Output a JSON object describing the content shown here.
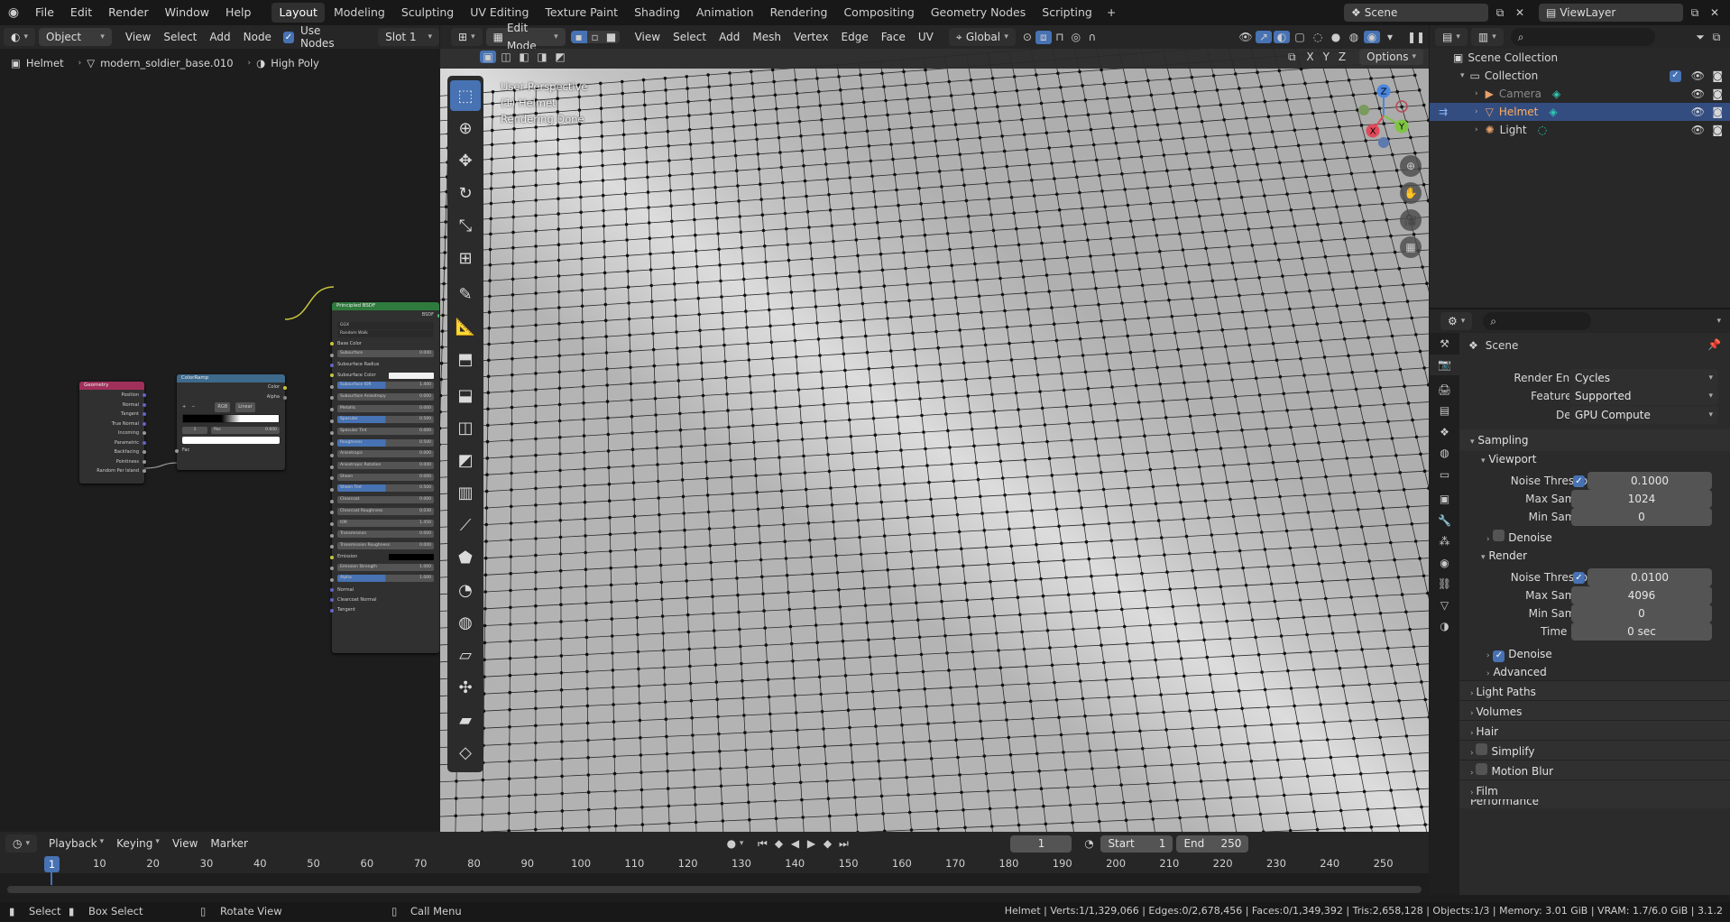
{
  "topbar": {
    "menus": [
      "File",
      "Edit",
      "Render",
      "Window",
      "Help"
    ],
    "workspaces": [
      "Layout",
      "Modeling",
      "Sculpting",
      "UV Editing",
      "Texture Paint",
      "Shading",
      "Animation",
      "Rendering",
      "Compositing",
      "Geometry Nodes",
      "Scripting"
    ],
    "active_workspace": "Layout",
    "add_tab": "+",
    "scene": "Scene",
    "view_layer": "ViewLayer"
  },
  "node_header": {
    "mode": "Object",
    "menus": [
      "View",
      "Select",
      "Add",
      "Node"
    ],
    "use_nodes": "Use Nodes",
    "slot": "Slot 1"
  },
  "breadcrumb": {
    "object": "Helmet",
    "mesh": "modern_soldier_base.010",
    "material": "High Poly"
  },
  "nodes": {
    "geometry": {
      "title": "Geometry",
      "outputs": [
        "Position",
        "Normal",
        "Tangent",
        "True Normal",
        "Incoming",
        "Parametric",
        "Backfacing",
        "Pointiness",
        "Random Per Island"
      ]
    },
    "colorramp": {
      "title": "ColorRamp",
      "outputs": [
        "Color",
        "Alpha"
      ],
      "mode": "RGB",
      "interp": "Linear",
      "index": "1",
      "pos_label": "Pos",
      "pos": "0.600",
      "input": "Fac"
    },
    "bsdf": {
      "title": "Principled BSDF",
      "output": "BSDF",
      "distribution": "GGX",
      "subsurface_method": "Random Walk",
      "rows": [
        {
          "label": "Base Color",
          "kind": "plain"
        },
        {
          "label": "Subsurface",
          "value": "0.000",
          "kind": "bar"
        },
        {
          "label": "Subsurface Radius",
          "kind": "dropdown"
        },
        {
          "label": "Subsurface Color",
          "kind": "color"
        },
        {
          "label": "Subsurface IOR",
          "value": "1.400",
          "kind": "blue"
        },
        {
          "label": "Subsurface Anisotropy",
          "value": "0.000",
          "kind": "bar"
        },
        {
          "label": "Metallic",
          "value": "0.000",
          "kind": "bar"
        },
        {
          "label": "Specular",
          "value": "0.500",
          "kind": "blue"
        },
        {
          "label": "Specular Tint",
          "value": "0.000",
          "kind": "bar"
        },
        {
          "label": "Roughness",
          "value": "0.500",
          "kind": "blue"
        },
        {
          "label": "Anisotropic",
          "value": "0.000",
          "kind": "bar"
        },
        {
          "label": "Anisotropic Rotation",
          "value": "0.000",
          "kind": "bar"
        },
        {
          "label": "Sheen",
          "value": "0.000",
          "kind": "bar"
        },
        {
          "label": "Sheen Tint",
          "value": "0.500",
          "kind": "blue"
        },
        {
          "label": "Clearcoat",
          "value": "0.000",
          "kind": "bar"
        },
        {
          "label": "Clearcoat Roughness",
          "value": "0.030",
          "kind": "bar"
        },
        {
          "label": "IOR",
          "value": "1.450",
          "kind": "bar"
        },
        {
          "label": "Transmission",
          "value": "0.000",
          "kind": "bar"
        },
        {
          "label": "Transmission Roughness",
          "value": "0.000",
          "kind": "bar"
        },
        {
          "label": "Emission",
          "kind": "black"
        },
        {
          "label": "Emission Strength",
          "value": "1.000",
          "kind": "bar"
        },
        {
          "label": "Alpha",
          "value": "1.000",
          "kind": "blue"
        },
        {
          "label": "Normal",
          "kind": "plain"
        },
        {
          "label": "Clearcoat Normal",
          "kind": "plain"
        },
        {
          "label": "Tangent",
          "kind": "plain"
        }
      ]
    }
  },
  "viewport_header": {
    "mode": "Edit Mode",
    "menus": [
      "View",
      "Select",
      "Add",
      "Mesh",
      "Vertex",
      "Edge",
      "Face",
      "UV"
    ],
    "orientation": "Global",
    "options": "Options",
    "axes": [
      "X",
      "Y",
      "Z"
    ]
  },
  "viewport_overlay": {
    "line1": "User Perspective",
    "line2": "(1) Helmet",
    "line3": "Rendering Done"
  },
  "gizmo": {
    "x": "X",
    "y": "Y",
    "z": "Z"
  },
  "outliner": {
    "root": "Scene Collection",
    "collection": "Collection",
    "items": [
      {
        "name": "Camera",
        "selected": false,
        "dim": true,
        "color": "#e8a06b"
      },
      {
        "name": "Helmet",
        "selected": true,
        "dim": false,
        "color": "#e8a06b"
      },
      {
        "name": "Light",
        "selected": false,
        "dim": false,
        "color": "#e8a06b"
      }
    ]
  },
  "properties": {
    "context": "Scene",
    "render_engine_label": "Render Engine",
    "render_engine": "Cycles",
    "feature_set_label": "Feature Set",
    "feature_set": "Supported",
    "device_label": "Device",
    "device": "GPU Compute",
    "sampling": "Sampling",
    "viewport": "Viewport",
    "vp_noise_label": "Noise Threshold",
    "vp_noise": "0.1000",
    "vp_max_label": "Max Samples",
    "vp_max": "1024",
    "vp_min_label": "Min Samples",
    "vp_min": "0",
    "vp_denoise": "Denoise",
    "render": "Render",
    "r_noise_label": "Noise Threshold",
    "r_noise": "0.0100",
    "r_max_label": "Max Samples",
    "r_max": "4096",
    "r_min_label": "Min Samples",
    "r_min": "0",
    "r_time_label": "Time Limit",
    "r_time": "0 sec",
    "r_denoise": "Denoise",
    "advanced": "Advanced",
    "sections": [
      "Light Paths",
      "Volumes",
      "Hair",
      "Simplify",
      "Motion Blur",
      "Film"
    ],
    "peek": "Performance"
  },
  "timeline": {
    "menus": [
      "Playback",
      "Keying",
      "View",
      "Marker"
    ],
    "current": "1",
    "start_label": "Start",
    "start": "1",
    "end_label": "End",
    "end": "250",
    "ticks": [
      "1",
      "10",
      "20",
      "30",
      "40",
      "50",
      "60",
      "70",
      "80",
      "90",
      "100",
      "110",
      "120",
      "130",
      "140",
      "150",
      "160",
      "170",
      "180",
      "190",
      "200",
      "210",
      "220",
      "230",
      "240",
      "250"
    ]
  },
  "statusbar": {
    "select": "Select",
    "box_select": "Box Select",
    "rotate": "Rotate View",
    "call_menu": "Call Menu",
    "stats": "Helmet | Verts:1/1,329,066 | Edges:0/2,678,456 | Faces:0/1,349,392 | Tris:2,658,128 | Objects:1/3 | Memory: 3.01 GiB | VRAM: 1.7/6.0 GiB | 3.1.2"
  }
}
